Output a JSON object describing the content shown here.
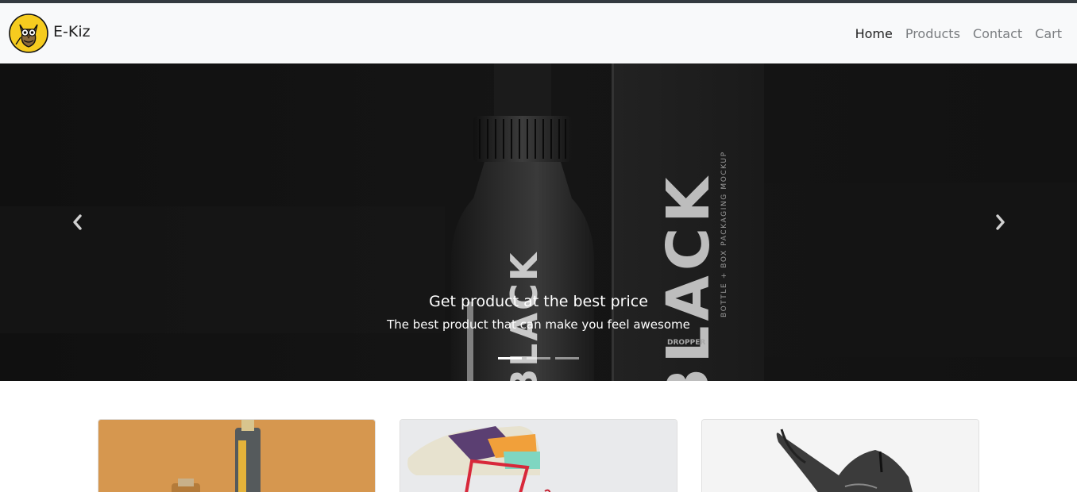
{
  "brand": {
    "name": "E-Kiz",
    "logo_icon": "owl-logo-icon"
  },
  "nav": {
    "links": [
      "Home",
      "Products",
      "Contact",
      "Cart"
    ],
    "active": "Home"
  },
  "carousel": {
    "slide_image": "black-dropper-bottle-box-mockup",
    "bottle_text": "BLACK",
    "box_title": "BLACK",
    "box_subtitle": "BOTTLE + BOX PACKAGING MOCKUP",
    "box_label": "DROPPER",
    "caption_title": "Get product at the best price",
    "caption_text": "The best product that can make you feel awesome",
    "indicators": 3,
    "active_indicator": 0,
    "prev_icon": "chevron-left-icon",
    "next_icon": "chevron-right-icon"
  },
  "products": [
    {
      "image": "perfume-bottle-on-orange-background"
    },
    {
      "image": "colorful-sneaker-with-red-laces"
    },
    {
      "image": "black-sneaker-on-white-background"
    }
  ],
  "colors": {
    "navbar_bg": "#f8f9fa",
    "carousel_bg": "#0c0c0c",
    "logo_yellow": "#f6cc1f"
  }
}
